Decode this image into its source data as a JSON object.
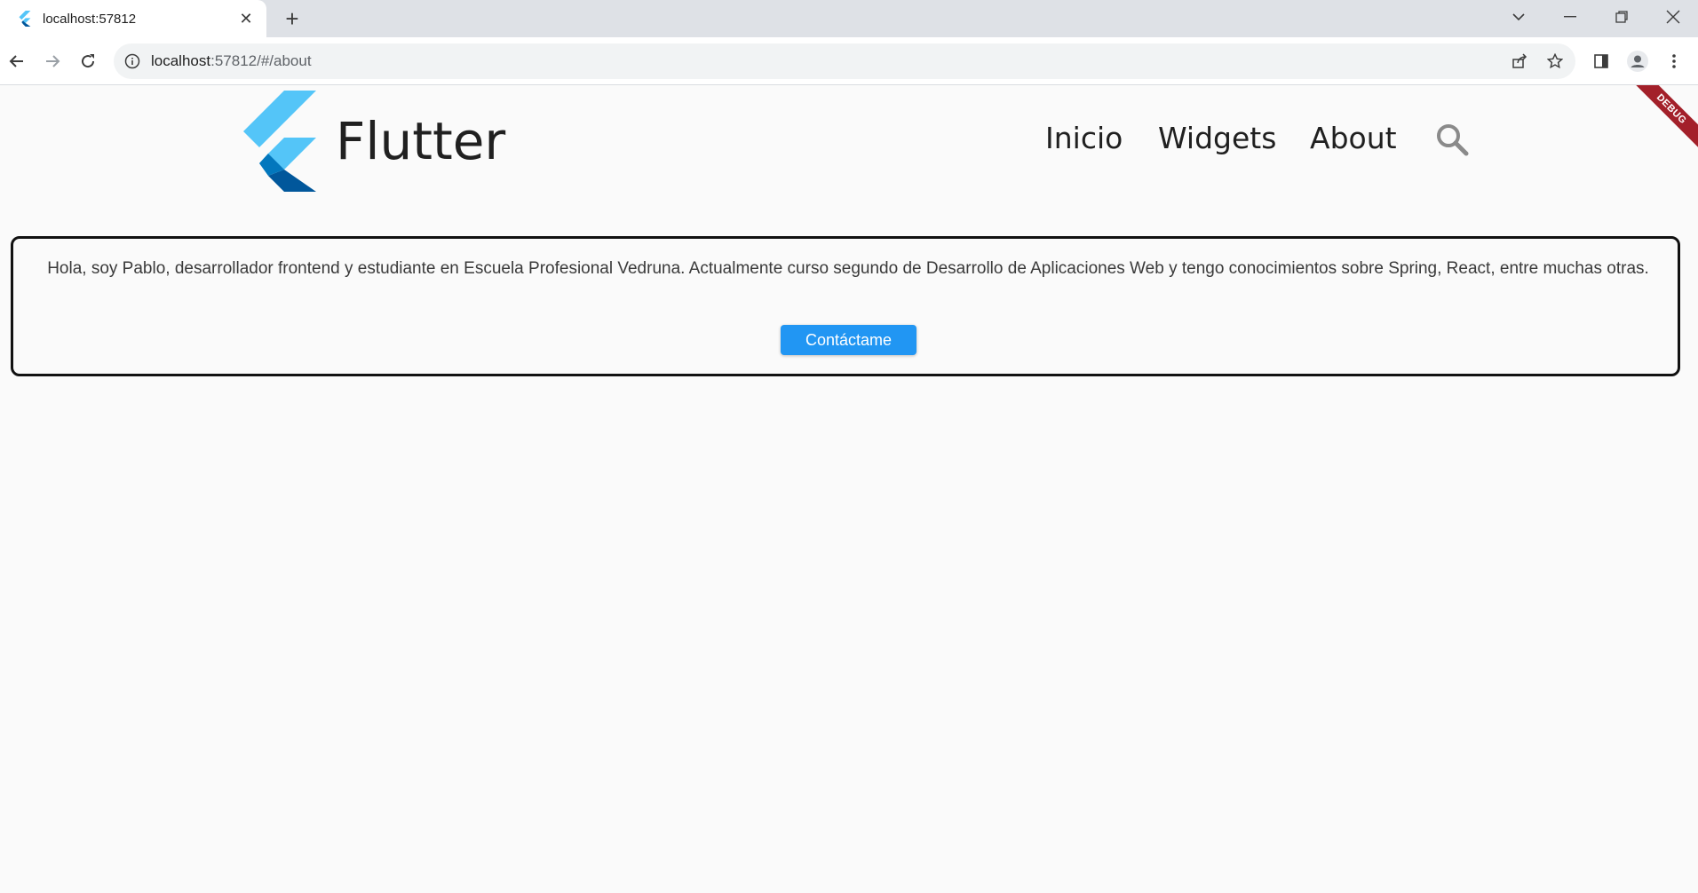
{
  "browser": {
    "tab": {
      "title": "localhost:57812",
      "close_icon": "close-icon"
    },
    "new_tab_label": "+",
    "address": {
      "host": "localhost",
      "rest": ":57812/#/about"
    }
  },
  "app": {
    "logo_text": "Flutter",
    "nav": {
      "inicio": "Inicio",
      "widgets": "Widgets",
      "about": "About"
    },
    "debug_label": "DEBUG",
    "about": {
      "text": "Hola, soy Pablo, desarrollador frontend y estudiante en Escuela Profesional Vedruna. Actualmente curso segundo de Desarrollo de Aplicaciones Web y tengo conocimientos sobre Spring, React, entre muchas otras.",
      "button_label": "Contáctame"
    }
  },
  "colors": {
    "accent_button": "#2196f3",
    "flutter_light": "#54c5f8",
    "flutter_mid": "#29b6f6",
    "flutter_dark": "#01579b",
    "debug_banner": "#a3202a"
  }
}
